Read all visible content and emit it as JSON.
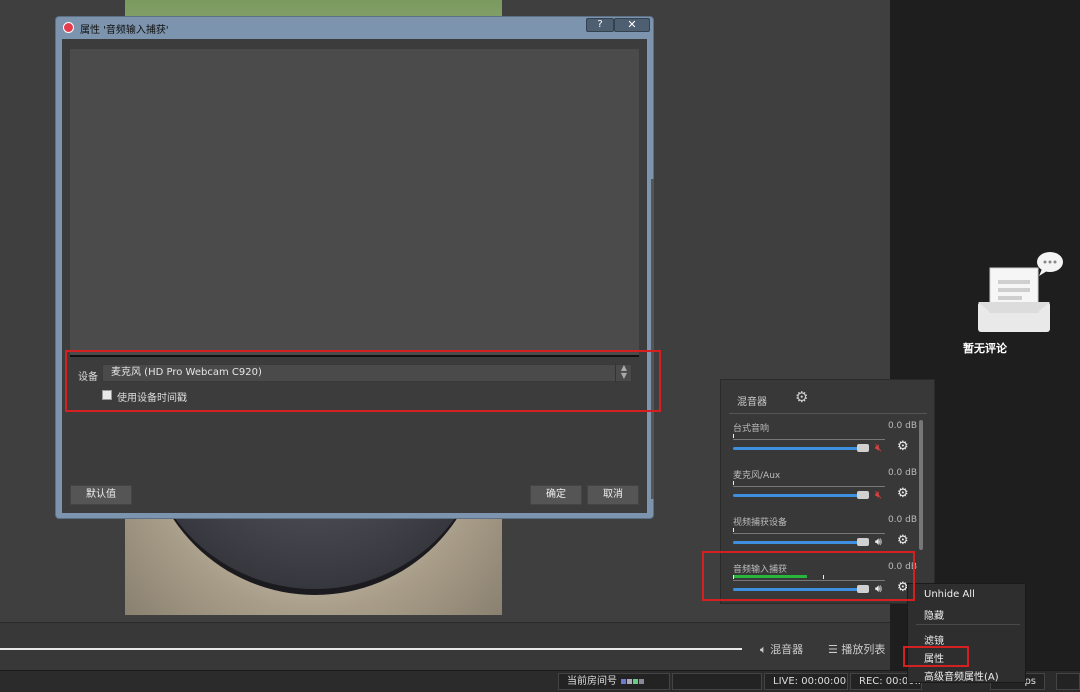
{
  "dialog": {
    "title": "属性 '音频输入捕获'",
    "help": "?",
    "close": "✕",
    "device_label": "设备",
    "device_value": "麦克风 (HD Pro Webcam C920)",
    "timestamp_checkbox": "使用设备时间戳",
    "timestamp_checked": false,
    "btn_default": "默认值",
    "btn_ok": "确定",
    "btn_cancel": "取消"
  },
  "mixer": {
    "title": "混音器",
    "channels": [
      {
        "name": "台式音响",
        "db": "0.0 dB",
        "muted": true,
        "meter_level": 0
      },
      {
        "name": "麦克风/Aux",
        "db": "0.0 dB",
        "muted": true,
        "meter_level": 0
      },
      {
        "name": "视频捕获设备",
        "db": "0.0 dB",
        "muted": false,
        "meter_level": 0
      },
      {
        "name": "音频输入捕获",
        "db": "0.0 dB",
        "muted": false,
        "meter_level": 0.48
      }
    ],
    "slider_level": 1.0
  },
  "context_menu": {
    "items": [
      "Unhide All",
      "隐藏",
      "滤镜",
      "属性",
      "高级音频属性(A)"
    ]
  },
  "dock_tabs": {
    "mixer": "混音器",
    "playlist": "播放列表"
  },
  "comments": {
    "empty_text": "暂无评论"
  },
  "status_bar": {
    "room_label": "当前房间号",
    "live": "LIVE: 00:00:00",
    "rec": "REC: 00:00...",
    "fps": "ps"
  },
  "colors": {
    "highlight": "#d42020",
    "accent": "#3f8fe0",
    "meter": "#27b53c"
  }
}
